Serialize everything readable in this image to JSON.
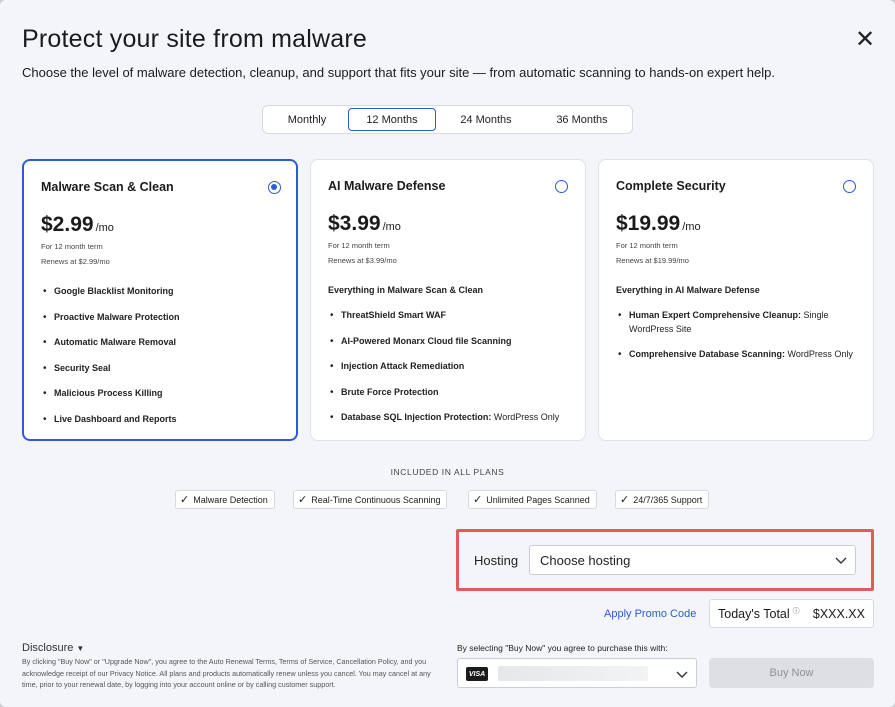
{
  "header": {
    "title": "Protect your site from malware",
    "subtitle": "Choose the level of malware detection, cleanup, and support that fits your site — from automatic scanning to hands-on expert help.",
    "close_icon": "close-icon"
  },
  "terms": {
    "options": [
      "Monthly",
      "12 Months",
      "24 Months",
      "36 Months"
    ],
    "selected": "12 Months"
  },
  "plans": [
    {
      "name": "Malware Scan & Clean",
      "price": "$2.99",
      "per": "/mo",
      "term_note": "For 12 month term",
      "renew_note": "Renews at $2.99/mo",
      "intro": "",
      "selected": true,
      "features": [
        {
          "bold": "Google Blacklist Monitoring",
          "rest": ""
        },
        {
          "bold": "Proactive Malware Protection",
          "rest": ""
        },
        {
          "bold": "Automatic Malware Removal",
          "rest": ""
        },
        {
          "bold": "Security Seal",
          "rest": ""
        },
        {
          "bold": "Malicious Process Killing",
          "rest": ""
        },
        {
          "bold": "Live Dashboard and Reports",
          "rest": ""
        }
      ]
    },
    {
      "name": "AI Malware Defense",
      "price": "$3.99",
      "per": "/mo",
      "term_note": "For 12 month term",
      "renew_note": "Renews at $3.99/mo",
      "intro": "Everything in Malware Scan & Clean",
      "selected": false,
      "features": [
        {
          "bold": "ThreatShield Smart WAF",
          "rest": ""
        },
        {
          "bold": "AI-Powered Monarx Cloud file Scanning",
          "rest": ""
        },
        {
          "bold": "Injection Attack Remediation",
          "rest": ""
        },
        {
          "bold": "Brute Force Protection",
          "rest": ""
        },
        {
          "bold": "Database SQL Injection Protection:",
          "rest": " WordPress Only"
        }
      ]
    },
    {
      "name": "Complete Security",
      "price": "$19.99",
      "per": "/mo",
      "term_note": "For 12 month term",
      "renew_note": "Renews at $19.99/mo",
      "intro": "Everything in AI Malware Defense",
      "selected": false,
      "features": [
        {
          "bold": "Human Expert Comprehensive Cleanup:",
          "rest": " Single WordPress Site"
        },
        {
          "bold": "Comprehensive Database Scanning:",
          "rest": " WordPress Only"
        }
      ]
    }
  ],
  "included": {
    "label": "INCLUDED IN ALL PLANS",
    "items": [
      "Malware Detection",
      "Real-Time Continuous Scanning",
      "Unlimited Pages Scanned",
      "24/7/365 Support"
    ]
  },
  "hosting": {
    "label": "Hosting",
    "value": "Choose hosting"
  },
  "checkout": {
    "promo": "Apply Promo Code",
    "total_label": "Today's Total",
    "total_info": "ⓘ",
    "total_amount": "$XXX.XX",
    "disclosure_label": "Disclosure",
    "disclosure_text": "By clicking \"Buy Now\" or \"Upgrade Now\", you agree to the Auto Renewal Terms, Terms of Service, Cancellation Policy, and you acknowledge receipt of our Privacy Notice. All plans and products automatically renew unless you cancel. You may cancel at any time, prior to your renewal date, by logging into your account online or by calling customer support.",
    "agree_text": "By selecting \"Buy Now\" you agree to purchase this with:",
    "card_brand": "VISA",
    "buy_label": "Buy Now"
  },
  "colors": {
    "accent": "#2f5bd0",
    "highlight_frame": "#e25a5a",
    "background": "#f3f5fa"
  }
}
